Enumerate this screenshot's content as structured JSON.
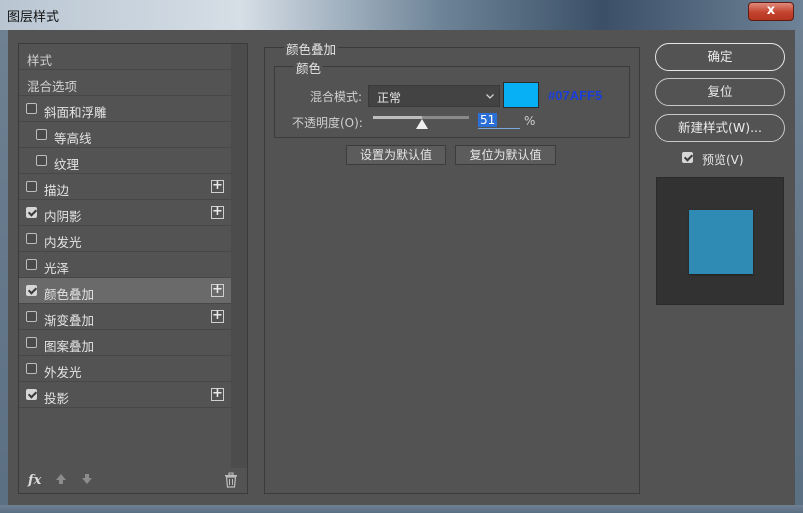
{
  "window": {
    "title": "图层样式",
    "close_glyph": "x"
  },
  "styles_list": {
    "header_styles": "样式",
    "header_blend": "混合选项",
    "items": [
      {
        "label": "斜面和浮雕",
        "checked": false,
        "indent": false,
        "plus": false
      },
      {
        "label": "等高线",
        "checked": false,
        "indent": true,
        "plus": false
      },
      {
        "label": "纹理",
        "checked": false,
        "indent": true,
        "plus": false
      },
      {
        "label": "描边",
        "checked": false,
        "indent": false,
        "plus": true
      },
      {
        "label": "内阴影",
        "checked": true,
        "indent": false,
        "plus": true
      },
      {
        "label": "内发光",
        "checked": false,
        "indent": false,
        "plus": false
      },
      {
        "label": "光泽",
        "checked": false,
        "indent": false,
        "plus": false
      },
      {
        "label": "颜色叠加",
        "checked": true,
        "indent": false,
        "plus": true,
        "selected": true
      },
      {
        "label": "渐变叠加",
        "checked": false,
        "indent": false,
        "plus": true
      },
      {
        "label": "图案叠加",
        "checked": false,
        "indent": false,
        "plus": false
      },
      {
        "label": "外发光",
        "checked": false,
        "indent": false,
        "plus": false
      },
      {
        "label": "投影",
        "checked": true,
        "indent": false,
        "plus": true
      }
    ],
    "plus_glyph": "+",
    "fx_label": "fx"
  },
  "color_overlay": {
    "section_title": "颜色叠加",
    "group_title": "颜色",
    "blend_mode_label": "混合模式:",
    "blend_mode_value": "正常",
    "color_hex": "#07AFF5",
    "color_value": "#07aff5",
    "opacity_label": "不透明度(O):",
    "opacity_value": "51",
    "opacity_fraction": 0.51,
    "percent_sign": "%",
    "set_default_label": "设置为默认值",
    "reset_default_label": "复位为默认值"
  },
  "actions": {
    "ok_label": "确定",
    "reset_label": "复位",
    "new_style_label": "新建样式(W)...",
    "preview_label": "预览(V)",
    "preview_checked": true
  },
  "preview": {
    "square_color": "#2f8bb4"
  }
}
